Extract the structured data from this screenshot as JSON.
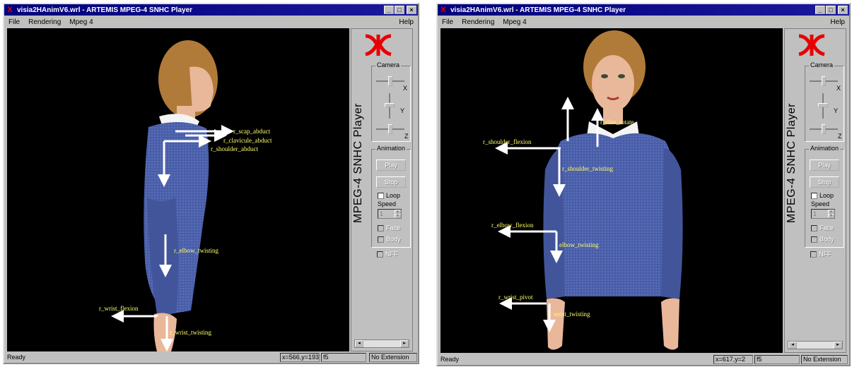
{
  "windows": [
    {
      "title": "visia2HAnimV6.wrl - ARTEMIS MPEG-4 SNHC Player",
      "menu": [
        "File",
        "Rendering",
        "Mpeg 4"
      ],
      "help": "Help",
      "caption_buttons": [
        "_",
        "□",
        "×"
      ],
      "player_title": "MPEG-4 SNHC Player",
      "camera_label": "Camera",
      "axis_labels": [
        "X",
        "Y",
        "Z"
      ],
      "animation_label": "Animation",
      "play_label": "Play",
      "stop_label": "Stop",
      "loop_label": "Loop",
      "speed_label": "Speed",
      "speed_value": "1",
      "face_label": "Face",
      "body_label": "Body",
      "nff_label": "NFF",
      "status": "Ready",
      "coords": "x=566,y=193",
      "f_value": "f5",
      "extension": "No Extension",
      "joint_labels": [
        "r_scap_abduct",
        "r_clavicule_abduct",
        "r_shoulder_abduct",
        "r_elbow_twisting",
        "r_wrist_flexion",
        "r_wrist_twisting"
      ]
    },
    {
      "title": "visia2HAnimV6.wrl - ARTEMIS MPEG-4 SNHC Player",
      "menu": [
        "File",
        "Rendering",
        "Mpeg 4"
      ],
      "help": "Help",
      "caption_buttons": [
        "_",
        "□",
        "×"
      ],
      "player_title": "MPEG-4 SNHC Player",
      "camera_label": "Camera",
      "axis_labels": [
        "X",
        "Y",
        "Z"
      ],
      "animation_label": "Animation",
      "play_label": "Play",
      "stop_label": "Stop",
      "loop_label": "Loop",
      "speed_label": "Speed",
      "speed_value": "1",
      "face_label": "Face",
      "body_label": "Body",
      "nff_label": "NFF",
      "status": "Ready",
      "coords": "x=617,y=2",
      "f_value": "f5",
      "extension": "No Extension",
      "joint_labels": [
        "r_clav_rotate",
        "r_shoulder_flexion",
        "r_shoulder_twisting",
        "r_elbow_flexion",
        "elbow_twisting",
        "r_wrist_pivot",
        "wrist_twisting"
      ]
    }
  ],
  "colors": {
    "titlebar": "#00007b",
    "viewport": "#000000",
    "label": "#ffff66",
    "sweater": "#4a5ea8",
    "hair": "#b07a38",
    "skin": "#e9b89a"
  }
}
